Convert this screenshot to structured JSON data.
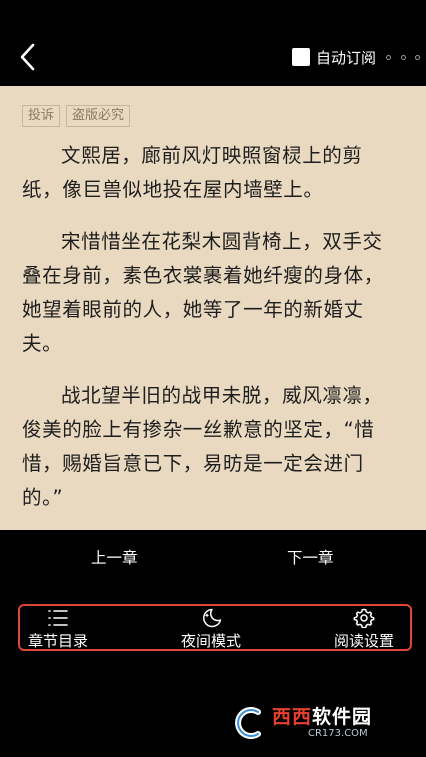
{
  "header": {
    "back_icon": "chevron-left-icon",
    "auto_subscribe_label": "自动订阅",
    "auto_subscribe_checked": false,
    "more_icon": "more-dots-icon"
  },
  "reader": {
    "background_color": "#e9d9c0",
    "tags": [
      "投诉",
      "盗版必究"
    ],
    "paragraphs": [
      "文熙居，廊前风灯映照窗棂上的剪纸，像巨兽似地投在屋内墙壁上。",
      "宋惜惜坐在花梨木圆背椅上，双手交叠在身前，素色衣裳裹着她纤瘦的身体，她望着眼前的人，她等了一年的新婚丈夫。",
      "战北望半旧的战甲未脱，威风凛凛，俊美的脸上有掺杂一丝歉意的坚定，“惜惜，赐婚旨意已下，易昉是一定会进门的。”"
    ]
  },
  "chapter_nav": {
    "prev_label": "上一章",
    "next_label": "下一章"
  },
  "toolbar": {
    "highlight_color": "#e0443a",
    "items": [
      {
        "icon": "list-icon",
        "label": "章节目录"
      },
      {
        "icon": "moon-icon",
        "label": "夜间模式"
      },
      {
        "icon": "gear-icon",
        "label": "阅读设置"
      }
    ]
  },
  "watermark": {
    "brand_red": "西西",
    "brand_white": "软件园",
    "site": "CR173.COM"
  }
}
